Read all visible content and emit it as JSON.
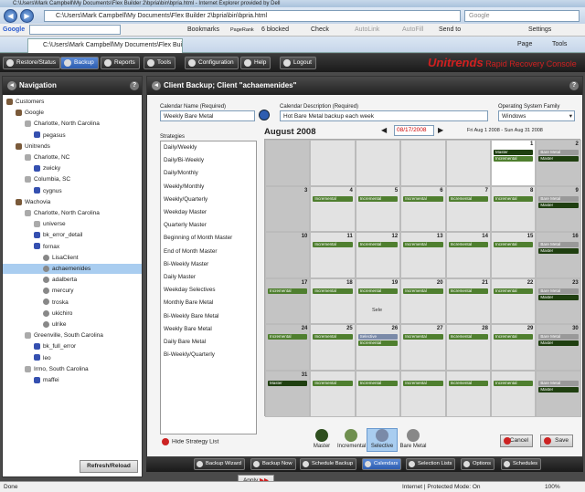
{
  "browser": {
    "title": "C:\\Users\\Mark Campbell\\My Documents\\Flex Builder 2\\bpria\\bin\\bpria.html - Internet Explorer provided by Dell",
    "address": "C:\\Users\\Mark Campbell\\My Documents\\Flex Builder 2\\bpria\\bin\\bpria.html",
    "search_placeholder": "Google",
    "tab_title": "C:\\Users\\Mark Campbell\\My Documents\\Flex Bui...",
    "google_bar": {
      "label": "Google",
      "bookmarks": "Bookmarks",
      "pagerank": "PageRank",
      "blocked": "6 blocked",
      "check": "Check",
      "autolink": "AutoLink",
      "autofill": "AutoFill",
      "send_to": "Send to",
      "settings": "Settings"
    },
    "page_menu": "Page",
    "tools_menu": "Tools"
  },
  "app_toolbar": {
    "buttons": [
      "Restore/Status",
      "Backup",
      "Reports",
      "Tools",
      "Configuration",
      "Help",
      "Logout"
    ],
    "brand_name": "Unitrends",
    "brand_tagline": "Rapid Recovery Console"
  },
  "navigation": {
    "title": "Navigation",
    "refresh_label": "Refresh/Reload",
    "tree": [
      {
        "label": "Customers",
        "level": 0,
        "icon": "customers"
      },
      {
        "label": "Google",
        "level": 1,
        "icon": "customer"
      },
      {
        "label": "Charlotte, North Carolina",
        "level": 2,
        "icon": "location"
      },
      {
        "label": "pegasus",
        "level": 3,
        "icon": "server"
      },
      {
        "label": "Unitrends",
        "level": 1,
        "icon": "customer"
      },
      {
        "label": "Charlotte, NC",
        "level": 2,
        "icon": "location"
      },
      {
        "label": "zwicky",
        "level": 3,
        "icon": "server"
      },
      {
        "label": "Columbia, SC",
        "level": 2,
        "icon": "location"
      },
      {
        "label": "cygnus",
        "level": 3,
        "icon": "server"
      },
      {
        "label": "Wachovia",
        "level": 1,
        "icon": "customer"
      },
      {
        "label": "Charlotte, North Carolina",
        "level": 2,
        "icon": "location"
      },
      {
        "label": "universe",
        "level": 3,
        "icon": "database"
      },
      {
        "label": "bk_error_detail",
        "level": 3,
        "icon": "server"
      },
      {
        "label": "fornax",
        "level": 3,
        "icon": "server"
      },
      {
        "label": "LisaClient",
        "level": 4,
        "icon": "client"
      },
      {
        "label": "achaemenides",
        "level": 4,
        "icon": "client",
        "selected": true
      },
      {
        "label": "adalberta",
        "level": 4,
        "icon": "client"
      },
      {
        "label": "mercury",
        "level": 4,
        "icon": "client"
      },
      {
        "label": "troska",
        "level": 4,
        "icon": "client"
      },
      {
        "label": "ukichiro",
        "level": 4,
        "icon": "client"
      },
      {
        "label": "ulrike",
        "level": 4,
        "icon": "client"
      },
      {
        "label": "Greenville, South Carolina",
        "level": 2,
        "icon": "location"
      },
      {
        "label": "bk_full_error",
        "level": 3,
        "icon": "server"
      },
      {
        "label": "leo",
        "level": 3,
        "icon": "server"
      },
      {
        "label": "Irmo, South Carolina",
        "level": 2,
        "icon": "location"
      },
      {
        "label": "maffei",
        "level": 3,
        "icon": "server"
      }
    ]
  },
  "main": {
    "title": "Client Backup; Client \"achaemenides\"",
    "calendar_name_label": "Calendar Name (Required)",
    "calendar_name_value": "Weekly Bare Metal",
    "calendar_desc_label": "Calendar Description (Required)",
    "calendar_desc_value": "Hot Bare Metal backup each week",
    "os_family_label": "Operating System Family",
    "os_family_value": "Windows",
    "strategies_label": "Strategies",
    "strategies": [
      "Daily/Weekly",
      "Daily/Bi-Weekly",
      "Daily/Monthly",
      "Weekly/Monthly",
      "Weekly/Quarterly",
      "Weekday Master",
      "Quarterly Master",
      "Beginning of Month Master",
      "End of Month Master",
      "Bi-Weekly Master",
      "Daily Master",
      "Weekday Selectives",
      "Monthly Bare Metal",
      "Bi-Weekly Bare Metal",
      "Weekly Bare Metal",
      "Daily Bare Metal",
      "Bi-Weekly/Quarterly"
    ],
    "apply_label": "Apply",
    "hide_strategy_label": "Hide Strategy List",
    "month_title": "August 2008",
    "date_value": "08/17/2008",
    "date_range": "Fri Aug 1 2008 - Sun Aug 31 2008",
    "legend": [
      "Master",
      "Incremental",
      "Selective",
      "Bare Metal"
    ],
    "cancel_label": "Cancel",
    "save_label": "Save",
    "drag_hint": "Sele"
  },
  "calendar": {
    "weeks": [
      [
        {
          "n": ""
        },
        {
          "n": ""
        },
        {
          "n": ""
        },
        {
          "n": ""
        },
        {
          "n": ""
        },
        {
          "n": "1",
          "ev": [
            [
              "mas",
              "Master"
            ],
            [
              "inc",
              "Incremental"
            ]
          ]
        },
        {
          "n": "2",
          "ev": [
            [
              "bm",
              "Bare Metal"
            ],
            [
              "mas",
              "Master"
            ]
          ]
        }
      ],
      [
        {
          "n": "3"
        },
        {
          "n": "4",
          "ev": [
            [
              "inc",
              "Incremental"
            ]
          ]
        },
        {
          "n": "5",
          "ev": [
            [
              "inc",
              "Incremental"
            ]
          ]
        },
        {
          "n": "6",
          "ev": [
            [
              "inc",
              "Incremental"
            ]
          ]
        },
        {
          "n": "7",
          "ev": [
            [
              "inc",
              "Incremental"
            ]
          ]
        },
        {
          "n": "8",
          "ev": [
            [
              "inc",
              "Incremental"
            ]
          ]
        },
        {
          "n": "9",
          "ev": [
            [
              "bm",
              "Bare Metal"
            ],
            [
              "mas",
              "Master"
            ]
          ]
        }
      ],
      [
        {
          "n": "10"
        },
        {
          "n": "11",
          "ev": [
            [
              "inc",
              "Incremental"
            ]
          ]
        },
        {
          "n": "12",
          "ev": [
            [
              "inc",
              "Incremental"
            ]
          ]
        },
        {
          "n": "13",
          "ev": [
            [
              "inc",
              "Incremental"
            ]
          ]
        },
        {
          "n": "14",
          "ev": [
            [
              "inc",
              "Incremental"
            ]
          ]
        },
        {
          "n": "15",
          "ev": [
            [
              "inc",
              "Incremental"
            ]
          ]
        },
        {
          "n": "16",
          "ev": [
            [
              "bm",
              "Bare Metal"
            ],
            [
              "mas",
              "Master"
            ]
          ]
        }
      ],
      [
        {
          "n": "17",
          "ev": [
            [
              "inc",
              "Incremental"
            ]
          ]
        },
        {
          "n": "18",
          "ev": [
            [
              "inc",
              "Incremental"
            ]
          ]
        },
        {
          "n": "19",
          "ev": [
            [
              "inc",
              "Incremental"
            ]
          ]
        },
        {
          "n": "20",
          "ev": [
            [
              "inc",
              "Incremental"
            ]
          ]
        },
        {
          "n": "21",
          "ev": [
            [
              "inc",
              "Incremental"
            ]
          ]
        },
        {
          "n": "22",
          "ev": [
            [
              "inc",
              "Incremental"
            ]
          ]
        },
        {
          "n": "23",
          "ev": [
            [
              "bm",
              "Bare Metal"
            ],
            [
              "mas",
              "Master"
            ]
          ]
        }
      ],
      [
        {
          "n": "24",
          "ev": [
            [
              "inc",
              "Incremental"
            ]
          ]
        },
        {
          "n": "25",
          "ev": [
            [
              "inc",
              "Incremental"
            ]
          ]
        },
        {
          "n": "26",
          "ev": [
            [
              "sel",
              "Selective"
            ],
            [
              "inc",
              "Incremental"
            ]
          ]
        },
        {
          "n": "27",
          "ev": [
            [
              "inc",
              "Incremental"
            ]
          ]
        },
        {
          "n": "28",
          "ev": [
            [
              "inc",
              "Incremental"
            ]
          ]
        },
        {
          "n": "29",
          "ev": [
            [
              "inc",
              "Incremental"
            ]
          ]
        },
        {
          "n": "30",
          "ev": [
            [
              "bm",
              "Bare Metal"
            ],
            [
              "mas",
              "Master"
            ]
          ]
        }
      ],
      [
        {
          "n": "31",
          "ev": [
            [
              "mas",
              "Master"
            ]
          ]
        },
        {
          "n": "",
          "ev": [
            [
              "inc",
              "Incremental"
            ]
          ]
        },
        {
          "n": "",
          "ev": [
            [
              "inc",
              "Incremental"
            ]
          ]
        },
        {
          "n": "",
          "ev": [
            [
              "inc",
              "Incremental"
            ]
          ]
        },
        {
          "n": "",
          "ev": [
            [
              "inc",
              "Incremental"
            ]
          ]
        },
        {
          "n": "",
          "ev": [
            [
              "inc",
              "Incremental"
            ]
          ]
        },
        {
          "n": "",
          "ev": [
            [
              "bm",
              "Bare Metal"
            ],
            [
              "mas",
              "Master"
            ]
          ]
        }
      ]
    ]
  },
  "bottom_tabs": [
    "Backup Wizard",
    "Backup Now",
    "Schedule Backup",
    "Calendars",
    "Selection Lists",
    "Options",
    "Schedules"
  ],
  "status": {
    "left": "Done",
    "zone": "Internet | Protected Mode: On",
    "zoom": "100%"
  },
  "colors": {
    "incremental": "#4f7f2f",
    "master": "#1f3f10",
    "bare_metal": "#999999",
    "selective": "#7a8aa8",
    "brand": "#d02020",
    "active_tab": "#2d5db0"
  }
}
